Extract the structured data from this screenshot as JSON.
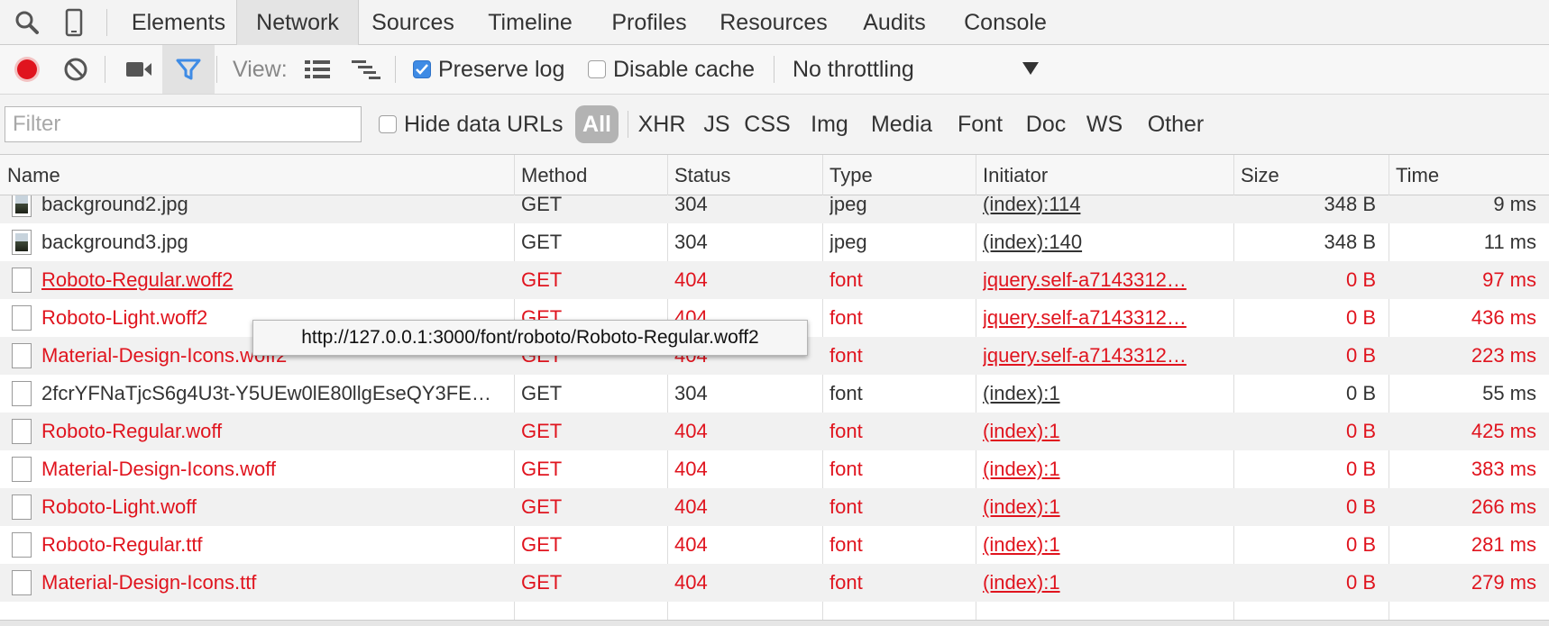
{
  "tabs": [
    "Elements",
    "Network",
    "Sources",
    "Timeline",
    "Profiles",
    "Resources",
    "Audits",
    "Console"
  ],
  "active_tab": "Network",
  "toolbar": {
    "view_label": "View:",
    "preserve_log_label": "Preserve log",
    "preserve_log_checked": true,
    "disable_cache_label": "Disable cache",
    "disable_cache_checked": false,
    "throttling_value": "No throttling"
  },
  "filter": {
    "placeholder": "Filter",
    "hide_data_urls_label": "Hide data URLs",
    "types": [
      "All",
      "XHR",
      "JS",
      "CSS",
      "Img",
      "Media",
      "Font",
      "Doc",
      "WS",
      "Other"
    ],
    "active_type": "All"
  },
  "columns": [
    "Name",
    "Method",
    "Status",
    "Type",
    "Initiator",
    "Size",
    "Time"
  ],
  "rows": [
    {
      "icon": "image-file-icon",
      "name": "background2.jpg",
      "method": "GET",
      "status": "304",
      "type": "jpeg",
      "initiator": "(index):114",
      "size": "348 B",
      "time": "9 ms",
      "error": false
    },
    {
      "icon": "image-file-icon",
      "name": "background3.jpg",
      "method": "GET",
      "status": "304",
      "type": "jpeg",
      "initiator": "(index):140",
      "size": "348 B",
      "time": "11 ms",
      "error": false
    },
    {
      "icon": "document-file-icon",
      "name": "Roboto-Regular.woff2",
      "method": "GET",
      "status": "404",
      "type": "font",
      "initiator": "jquery.self-a7143312…",
      "size": "0 B",
      "time": "97 ms",
      "error": true
    },
    {
      "icon": "document-file-icon",
      "name": "Roboto-Light.woff2",
      "method": "GET",
      "status": "404",
      "type": "font",
      "initiator": "jquery.self-a7143312…",
      "size": "0 B",
      "time": "436 ms",
      "error": true
    },
    {
      "icon": "document-file-icon",
      "name": "Material-Design-Icons.woff2",
      "method": "GET",
      "status": "404",
      "type": "font",
      "initiator": "jquery.self-a7143312…",
      "size": "0 B",
      "time": "223 ms",
      "error": true
    },
    {
      "icon": "document-file-icon",
      "name": "2fcrYFNaTjcS6g4U3t-Y5UEw0lE80llgEseQY3FE…",
      "method": "GET",
      "status": "304",
      "type": "font",
      "initiator": "(index):1",
      "size": "0 B",
      "time": "55 ms",
      "error": false
    },
    {
      "icon": "document-file-icon",
      "name": "Roboto-Regular.woff",
      "method": "GET",
      "status": "404",
      "type": "font",
      "initiator": "(index):1",
      "size": "0 B",
      "time": "425 ms",
      "error": true
    },
    {
      "icon": "document-file-icon",
      "name": "Material-Design-Icons.woff",
      "method": "GET",
      "status": "404",
      "type": "font",
      "initiator": "(index):1",
      "size": "0 B",
      "time": "383 ms",
      "error": true
    },
    {
      "icon": "document-file-icon",
      "name": "Roboto-Light.woff",
      "method": "GET",
      "status": "404",
      "type": "font",
      "initiator": "(index):1",
      "size": "0 B",
      "time": "266 ms",
      "error": true
    },
    {
      "icon": "document-file-icon",
      "name": "Roboto-Regular.ttf",
      "method": "GET",
      "status": "404",
      "type": "font",
      "initiator": "(index):1",
      "size": "0 B",
      "time": "281 ms",
      "error": true
    },
    {
      "icon": "document-file-icon",
      "name": "Material-Design-Icons.ttf",
      "method": "GET",
      "status": "404",
      "type": "font",
      "initiator": "(index):1",
      "size": "0 B",
      "time": "279 ms",
      "error": true
    }
  ],
  "tooltip": "http://127.0.0.1:3000/font/roboto/Roboto-Regular.woff2",
  "colors": {
    "error": "#e0141e",
    "record": "#e0141e",
    "filter_active": "#3e8be5"
  }
}
